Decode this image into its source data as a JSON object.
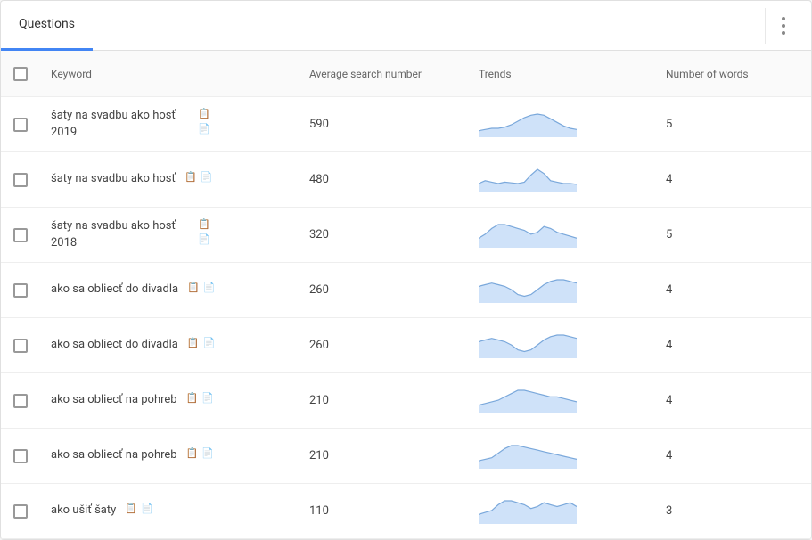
{
  "tabs": {
    "active": "Questions"
  },
  "columns": {
    "keyword": "Keyword",
    "avg": "Average search number",
    "trends": "Trends",
    "words": "Number of words"
  },
  "rows": [
    {
      "keyword": "šaty na svadbu ako hosť 2019",
      "avg": "590",
      "words": "5",
      "wrap": true,
      "trend": [
        8,
        10,
        12,
        12,
        14,
        18,
        24,
        30,
        34,
        36,
        34,
        28,
        22,
        16,
        12,
        10
      ]
    },
    {
      "keyword": "šaty na svadbu ako hosť",
      "avg": "480",
      "words": "4",
      "wrap": false,
      "trend": [
        10,
        14,
        12,
        10,
        12,
        11,
        10,
        12,
        22,
        30,
        24,
        14,
        12,
        10,
        10,
        9
      ]
    },
    {
      "keyword": "šaty na svadbu ako hosť 2018",
      "avg": "320",
      "words": "5",
      "wrap": true,
      "trend": [
        8,
        12,
        18,
        22,
        22,
        20,
        18,
        16,
        12,
        14,
        20,
        18,
        14,
        12,
        10,
        8
      ]
    },
    {
      "keyword": "ako sa obliecť do divadla",
      "avg": "260",
      "words": "4",
      "wrap": false,
      "trend": [
        18,
        20,
        22,
        20,
        18,
        14,
        8,
        6,
        8,
        14,
        20,
        24,
        26,
        26,
        24,
        22
      ]
    },
    {
      "keyword": "ako sa obliect do divadla",
      "avg": "260",
      "words": "4",
      "wrap": false,
      "trend": [
        18,
        20,
        22,
        20,
        18,
        14,
        8,
        6,
        8,
        14,
        20,
        24,
        26,
        26,
        24,
        22
      ]
    },
    {
      "keyword": "ako sa obliecť na pohreb",
      "avg": "210",
      "words": "4",
      "wrap": false,
      "trend": [
        8,
        10,
        12,
        14,
        18,
        22,
        26,
        26,
        24,
        22,
        20,
        18,
        18,
        16,
        14,
        12
      ]
    },
    {
      "keyword": "ako sa obliecť na pohreb",
      "avg": "210",
      "words": "4",
      "wrap": false,
      "trend": [
        8,
        10,
        12,
        18,
        24,
        28,
        28,
        26,
        24,
        22,
        20,
        18,
        16,
        14,
        12,
        10
      ]
    },
    {
      "keyword": "ako ušiť šaty",
      "avg": "110",
      "words": "3",
      "wrap": false,
      "trend": [
        8,
        10,
        12,
        18,
        22,
        22,
        20,
        18,
        14,
        16,
        20,
        18,
        16,
        18,
        20,
        16
      ]
    }
  ]
}
